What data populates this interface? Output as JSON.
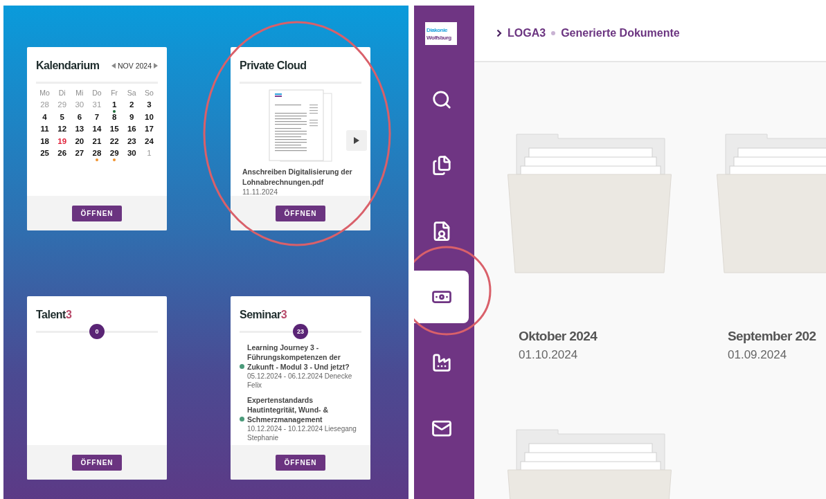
{
  "dashboard": {
    "cards": [
      {
        "kind": "calendar",
        "title": "Kalendarium",
        "month": "NOV 2024",
        "weekdays": [
          "Mo",
          "Di",
          "Mi",
          "Do",
          "Fr",
          "Sa",
          "So"
        ],
        "weeks": [
          [
            {
              "day": "28",
              "outside": true,
              "today": false
            },
            {
              "day": "29",
              "outside": true,
              "today": false
            },
            {
              "day": "30",
              "outside": true,
              "today": false
            },
            {
              "day": "31",
              "outside": true,
              "today": false
            },
            {
              "day": "1",
              "outside": false,
              "today": false,
              "color": "#1e6b3a"
            },
            {
              "day": "2",
              "outside": false,
              "today": false
            },
            {
              "day": "3",
              "outside": false,
              "today": false
            }
          ],
          [
            {
              "day": "4",
              "outside": false,
              "today": false
            },
            {
              "day": "5",
              "outside": false,
              "today": false
            },
            {
              "day": "6",
              "outside": false,
              "today": false
            },
            {
              "day": "7",
              "outside": false,
              "today": false
            },
            {
              "day": "8",
              "outside": false,
              "today": false
            },
            {
              "day": "9",
              "outside": false,
              "today": false
            },
            {
              "day": "10",
              "outside": false,
              "today": false
            }
          ],
          [
            {
              "day": "11",
              "outside": false,
              "today": false
            },
            {
              "day": "12",
              "outside": false,
              "today": false
            },
            {
              "day": "13",
              "outside": false,
              "today": false
            },
            {
              "day": "14",
              "outside": false,
              "today": false
            },
            {
              "day": "15",
              "outside": false,
              "today": false
            },
            {
              "day": "16",
              "outside": false,
              "today": false
            },
            {
              "day": "17",
              "outside": false,
              "today": false
            }
          ],
          [
            {
              "day": "18",
              "outside": false,
              "today": false
            },
            {
              "day": "19",
              "outside": false,
              "today": true
            },
            {
              "day": "20",
              "outside": false,
              "today": false
            },
            {
              "day": "21",
              "outside": false,
              "today": false
            },
            {
              "day": "22",
              "outside": false,
              "today": false
            },
            {
              "day": "23",
              "outside": false,
              "today": false
            },
            {
              "day": "24",
              "outside": false,
              "today": false
            }
          ],
          [
            {
              "day": "25",
              "outside": false,
              "today": false
            },
            {
              "day": "26",
              "outside": false,
              "today": false
            },
            {
              "day": "27",
              "outside": false,
              "today": false
            },
            {
              "day": "28",
              "outside": false,
              "today": false,
              "color": "#f0922e"
            },
            {
              "day": "29",
              "outside": false,
              "today": false,
              "color": "#f0922e"
            },
            {
              "day": "30",
              "outside": false,
              "today": false
            },
            {
              "day": "1",
              "outside": true,
              "today": false
            }
          ]
        ],
        "button": "ÖFFNEN"
      },
      {
        "kind": "cloud",
        "title": "Private Cloud",
        "document": {
          "name": "Anschreiben Digitalisierung der Lohnabrechnungen.pdf",
          "date": "11.11.2024"
        },
        "button": "ÖFFNEN"
      },
      {
        "kind": "counter",
        "title": "Talent",
        "title_suffix": "3",
        "count": "0",
        "button": "ÖFFNEN"
      },
      {
        "kind": "counter",
        "title": "Seminar",
        "title_suffix": "3",
        "count": "23",
        "events": [
          {
            "title": "Learning Journey 3 - Führungskompetenzen der Zukunft - Modul 3 - Und jetzt?",
            "details": "05.12.2024 - 06.12.2024 Denecke Felix"
          },
          {
            "title": "Expertenstandards Hautintegrität, Wund- & Schmerzmanagement",
            "details": "10.12.2024 - 10.12.2024 Liesegang Stephanie"
          }
        ],
        "button": "ÖFFNEN"
      }
    ]
  },
  "app": {
    "logo": [
      "Diakonie",
      "Wolfsburg"
    ],
    "nav": [
      {
        "kind": "search",
        "selected": false
      },
      {
        "kind": "documents",
        "selected": false
      },
      {
        "kind": "id-document",
        "selected": false
      },
      {
        "kind": "money",
        "selected": true
      },
      {
        "kind": "factory",
        "selected": false
      },
      {
        "kind": "mail",
        "selected": false
      }
    ],
    "breadcrumb": [
      "LOGA3",
      "Generierte Dokumente"
    ],
    "folders": [
      {
        "name": "Oktober 2024",
        "date": "01.10.2024"
      },
      {
        "name": "September 202",
        "date": "01.09.2024"
      }
    ]
  }
}
